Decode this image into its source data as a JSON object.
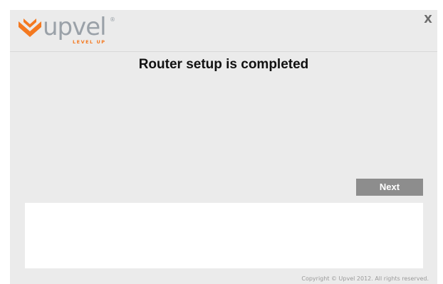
{
  "brand": {
    "name": "upvel",
    "registered": "®",
    "tagline": "LEVEL UP",
    "icon": "upvel-chevron-logo-icon",
    "colors": {
      "orange": "#f47920",
      "gray": "#9aa1a8"
    }
  },
  "window": {
    "close_label": "X",
    "background": "#ebebeb"
  },
  "main": {
    "title": "Router setup is completed",
    "next_label": "Next",
    "info_text": ""
  },
  "footer": {
    "copyright": "Copyright © Upvel 2012. All rights reserved."
  }
}
